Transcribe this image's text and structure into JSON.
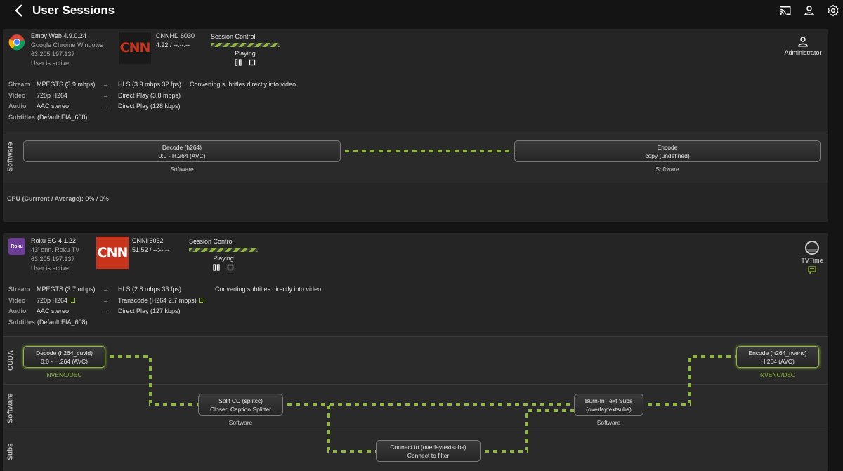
{
  "header": {
    "title": "User Sessions",
    "back_icon": "chevron-left-icon",
    "icons": [
      "cast-icon",
      "user-icon",
      "gear-icon"
    ]
  },
  "colors": {
    "accent": "#8fb63d",
    "background": "#141414",
    "card": "#252525",
    "cnn_red": "#c8331c"
  },
  "sessions": [
    {
      "client": {
        "name": "Emby Web 4.9.0.24",
        "device": "Google Chrome Windows",
        "ip": "63.205.197.137",
        "status": "User is active",
        "icon": "chrome-icon"
      },
      "channel": {
        "name": "CNNHD 6030",
        "time": "4:22 / --:--:--",
        "logo": "CNN"
      },
      "control": {
        "label": "Session Control",
        "status": "Playing",
        "pause_icon": "pause-icon",
        "stop_icon": "stop-icon"
      },
      "user": {
        "name": "Administrator",
        "icon": "user-icon"
      },
      "stream": {
        "stream": {
          "label": "Stream",
          "src": "MPEGTS (3.9 mbps)",
          "arrow": "→",
          "dst": "HLS (3.9 mbps 32 fps)",
          "note": "Converting subtitles directly into video"
        },
        "video": {
          "label": "Video",
          "src": "720p H264",
          "arrow": "→",
          "dst": "Direct Play (3.8 mbps)"
        },
        "audio": {
          "label": "Audio",
          "src": "AAC stereo",
          "arrow": "→",
          "dst": "Direct Play (128 kbps)"
        },
        "subtitles": {
          "label": "Subtitles",
          "value": "(Default EIA_608)"
        }
      },
      "pipeline": {
        "lanes": [
          "Software"
        ],
        "nodes": [
          {
            "title": "Decode (h264)",
            "subtitle": "0:0 - H.264 (AVC)",
            "caption": "Software"
          },
          {
            "title": "Encode",
            "subtitle": "copy (undefined)",
            "caption": "Software"
          }
        ]
      },
      "cpu": {
        "label": "CPU (Currrent / Average):",
        "value": "0% / 0%"
      }
    },
    {
      "client": {
        "name": "Roku SG 4.1.22",
        "device": "43' onn. Roku TV",
        "ip": "63.205.197.137",
        "status": "User is active",
        "icon": "roku-icon",
        "icon_text": "Roku"
      },
      "channel": {
        "name": "CNNI 6032",
        "time": "51:52 / --:--:--",
        "logo": "CNN"
      },
      "control": {
        "label": "Session Control",
        "status": "Playing",
        "pause_icon": "pause-icon",
        "stop_icon": "stop-icon"
      },
      "user": {
        "name": "TVTime",
        "icon": "avatar-icon",
        "chat_icon": "chat-icon"
      },
      "stream": {
        "stream": {
          "label": "Stream",
          "src": "MPEGTS (3.7 mbps)",
          "arrow": "→",
          "dst": "HLS (2.8 mbps 33 fps)",
          "note": "Converting subtitles directly into video"
        },
        "video": {
          "label": "Video",
          "src": "720p H264",
          "arrow": "→",
          "dst": "Transcode (H264 2.7 mbps)"
        },
        "audio": {
          "label": "Audio",
          "src": "AAC stereo",
          "arrow": "→",
          "dst": "Direct Play (127 kbps)"
        },
        "subtitles": {
          "label": "Subtitles",
          "value": "(Default EIA_608)"
        }
      },
      "pipeline": {
        "lanes": [
          "CUDA",
          "Software",
          "Subs"
        ],
        "nodes": [
          {
            "title": "Decode (h264_cuvid)",
            "subtitle": "0:0 - H.264 (AVC)",
            "caption": "NVENC/DEC"
          },
          {
            "title": "Split CC (splitcc)",
            "subtitle": "Closed Caption Splitter",
            "caption": "Software"
          },
          {
            "title": "Connect to (overlaytextsubs)",
            "subtitle": "Connect to filter",
            "caption": ""
          },
          {
            "title": "Burn-In Text Subs",
            "subtitle": "(overlaytextsubs)",
            "caption": "Software"
          },
          {
            "title": "Encode (h264_nvenc)",
            "subtitle": "H.264 (AVC)",
            "caption": "NVENC/DEC"
          }
        ]
      }
    }
  ]
}
